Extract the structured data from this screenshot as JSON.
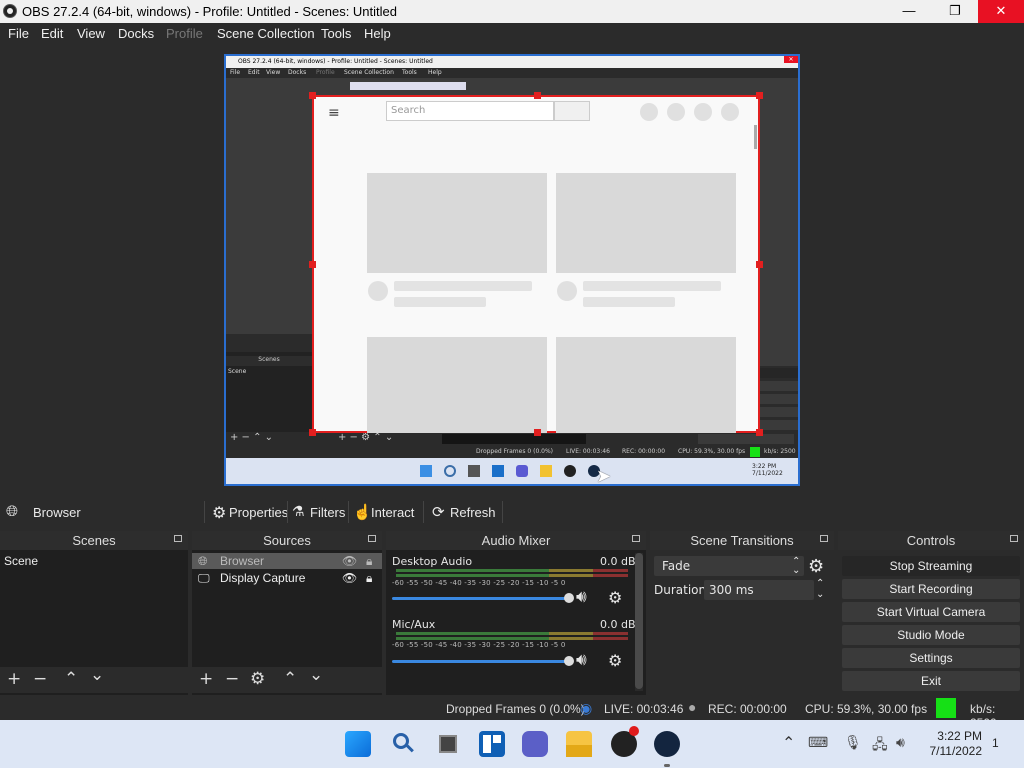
{
  "window": {
    "title": "OBS 27.2.4 (64-bit, windows) - Profile: Untitled - Scenes: Untitled",
    "minimize_icon": "minimize-icon",
    "maximize_icon": "restore-icon",
    "close_icon": "close-icon"
  },
  "menu": {
    "file": "File",
    "edit": "Edit",
    "view": "View",
    "docks": "Docks",
    "profile": "Profile",
    "scene_collection": "Scene Collection",
    "tools": "Tools",
    "help": "Help"
  },
  "preview": {
    "browser_search_placeholder": "Search"
  },
  "source_toolbar": {
    "selected_source": "Browser",
    "properties": "Properties",
    "filters": "Filters",
    "interact": "Interact",
    "refresh": "Refresh"
  },
  "scenes": {
    "header": "Scenes",
    "items": [
      "Scene"
    ]
  },
  "sources": {
    "header": "Sources",
    "items": [
      {
        "name": "Browser",
        "icon": "globe-icon",
        "selected": true
      },
      {
        "name": "Display Capture",
        "icon": "monitor-icon",
        "selected": false
      }
    ]
  },
  "audio_mixer": {
    "header": "Audio Mixer",
    "channels": [
      {
        "name": "Desktop Audio",
        "db": "0.0 dB"
      },
      {
        "name": "Mic/Aux",
        "db": "0.0 dB"
      }
    ],
    "scale": [
      "-60",
      "-55",
      "-50",
      "-45",
      "-40",
      "-35",
      "-30",
      "-25",
      "-20",
      "-15",
      "-10",
      "-5",
      "0"
    ]
  },
  "scene_transitions": {
    "header": "Scene Transitions",
    "transition": "Fade",
    "duration_label": "Duration",
    "duration_value": "300 ms"
  },
  "controls": {
    "header": "Controls",
    "stop_streaming": "Stop Streaming",
    "start_recording": "Start Recording",
    "start_virtual_camera": "Start Virtual Camera",
    "studio_mode": "Studio Mode",
    "settings": "Settings",
    "exit": "Exit"
  },
  "status": {
    "dropped_frames": "Dropped Frames 0 (0.0%)",
    "live": "LIVE: 00:03:46",
    "rec": "REC: 00:00:00",
    "cpu": "CPU: 59.3%, 30.00 fps",
    "kbps": "kb/s: 2500",
    "live_color": "#3a7bd5",
    "kbps_indicator_color": "#16e016"
  },
  "taskbar": {
    "time": "3:22 PM",
    "date": "7/11/2022",
    "notification_count": "1"
  }
}
